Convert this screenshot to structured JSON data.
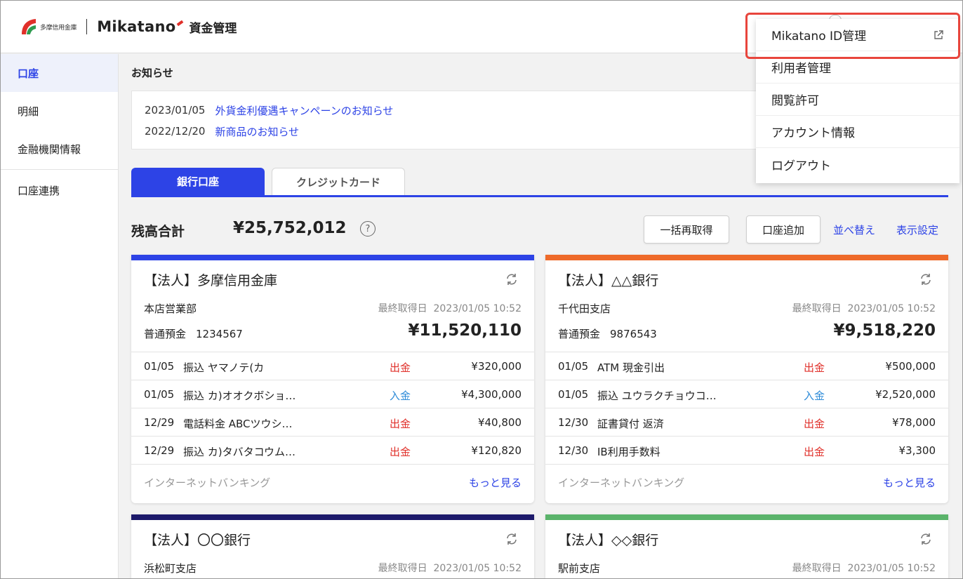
{
  "header": {
    "bank_name": "多摩信用金庫",
    "brand": "Mikatano",
    "brand_sub": "資金管理"
  },
  "sidebar": {
    "items": [
      {
        "label": "口座",
        "active": true
      },
      {
        "label": "明細"
      },
      {
        "label": "金融機関情報"
      },
      {
        "label": "口座連携"
      }
    ]
  },
  "notices": {
    "title": "お知らせ",
    "items": [
      {
        "date": "2023/01/05",
        "text": "外貨金利優遇キャンペーンのお知らせ"
      },
      {
        "date": "2022/12/20",
        "text": "新商品のお知らせ"
      }
    ]
  },
  "tabs": [
    {
      "label": "銀行口座",
      "active": true
    },
    {
      "label": "クレジットカード"
    }
  ],
  "summary": {
    "total_label": "残高合計",
    "total_value": "¥25,752,012",
    "help": "?",
    "refetch_all": "一括再取得",
    "add_account": "口座追加",
    "sort": "並べ替え",
    "display_settings": "表示設定"
  },
  "cards": [
    {
      "name": "【法人】多摩信用金庫",
      "color": "#2d43e6",
      "branch": "本店営業部",
      "last_fetch_label": "最終取得日",
      "last_fetch": "2023/01/05 10:52",
      "account_type": "普通預金",
      "account_no": "1234567",
      "balance": "¥11,520,110",
      "transactions": [
        {
          "date": "01/05",
          "desc": "振込 ヤマノテ(カ",
          "type": "出金",
          "dir": "out",
          "amount": "¥320,000"
        },
        {
          "date": "01/05",
          "desc": "振込 カ)オオクボショ…",
          "type": "入金",
          "dir": "in",
          "amount": "¥4,300,000"
        },
        {
          "date": "12/29",
          "desc": "電話料金 ABCツウシ…",
          "type": "出金",
          "dir": "out",
          "amount": "¥40,800"
        },
        {
          "date": "12/29",
          "desc": "振込 カ)タバタコウム…",
          "type": "出金",
          "dir": "out",
          "amount": "¥120,820"
        }
      ],
      "footer_label": "インターネットバンキング",
      "more": "もっと見る"
    },
    {
      "name": "【法人】△△銀行",
      "color": "#ee6a2a",
      "branch": "千代田支店",
      "last_fetch_label": "最終取得日",
      "last_fetch": "2023/01/05 10:52",
      "account_type": "普通預金",
      "account_no": "9876543",
      "balance": "¥9,518,220",
      "transactions": [
        {
          "date": "01/05",
          "desc": "ATM 現金引出",
          "type": "出金",
          "dir": "out",
          "amount": "¥500,000"
        },
        {
          "date": "01/05",
          "desc": "振込 ユウラクチョウコ…",
          "type": "入金",
          "dir": "in",
          "amount": "¥2,520,000"
        },
        {
          "date": "12/30",
          "desc": "証書貸付 返済",
          "type": "出金",
          "dir": "out",
          "amount": "¥78,000"
        },
        {
          "date": "12/30",
          "desc": "IB利用手数料",
          "type": "出金",
          "dir": "out",
          "amount": "¥3,300"
        }
      ],
      "footer_label": "インターネットバンキング",
      "more": "もっと見る"
    },
    {
      "name": "【法人】〇〇銀行",
      "color": "#1d1a6b",
      "branch": "浜松町支店",
      "last_fetch_label": "最終取得日",
      "last_fetch": "2023/01/05 10:52"
    },
    {
      "name": "【法人】◇◇銀行",
      "color": "#5ab36a",
      "branch": "駅前支店",
      "last_fetch_label": "最終取得日",
      "last_fetch": "2023/01/05 10:52"
    }
  ],
  "dropdown": {
    "items": [
      {
        "label": "Mikatano ID管理",
        "external": true
      },
      {
        "label": "利用者管理"
      },
      {
        "label": "閲覧許可"
      },
      {
        "label": "アカウント情報"
      },
      {
        "label": "ログアウト"
      }
    ]
  },
  "colors": {
    "accent": "#2d43e6",
    "out": "#e0302a",
    "in": "#2d8bd8",
    "highlight": "#e8453c"
  }
}
